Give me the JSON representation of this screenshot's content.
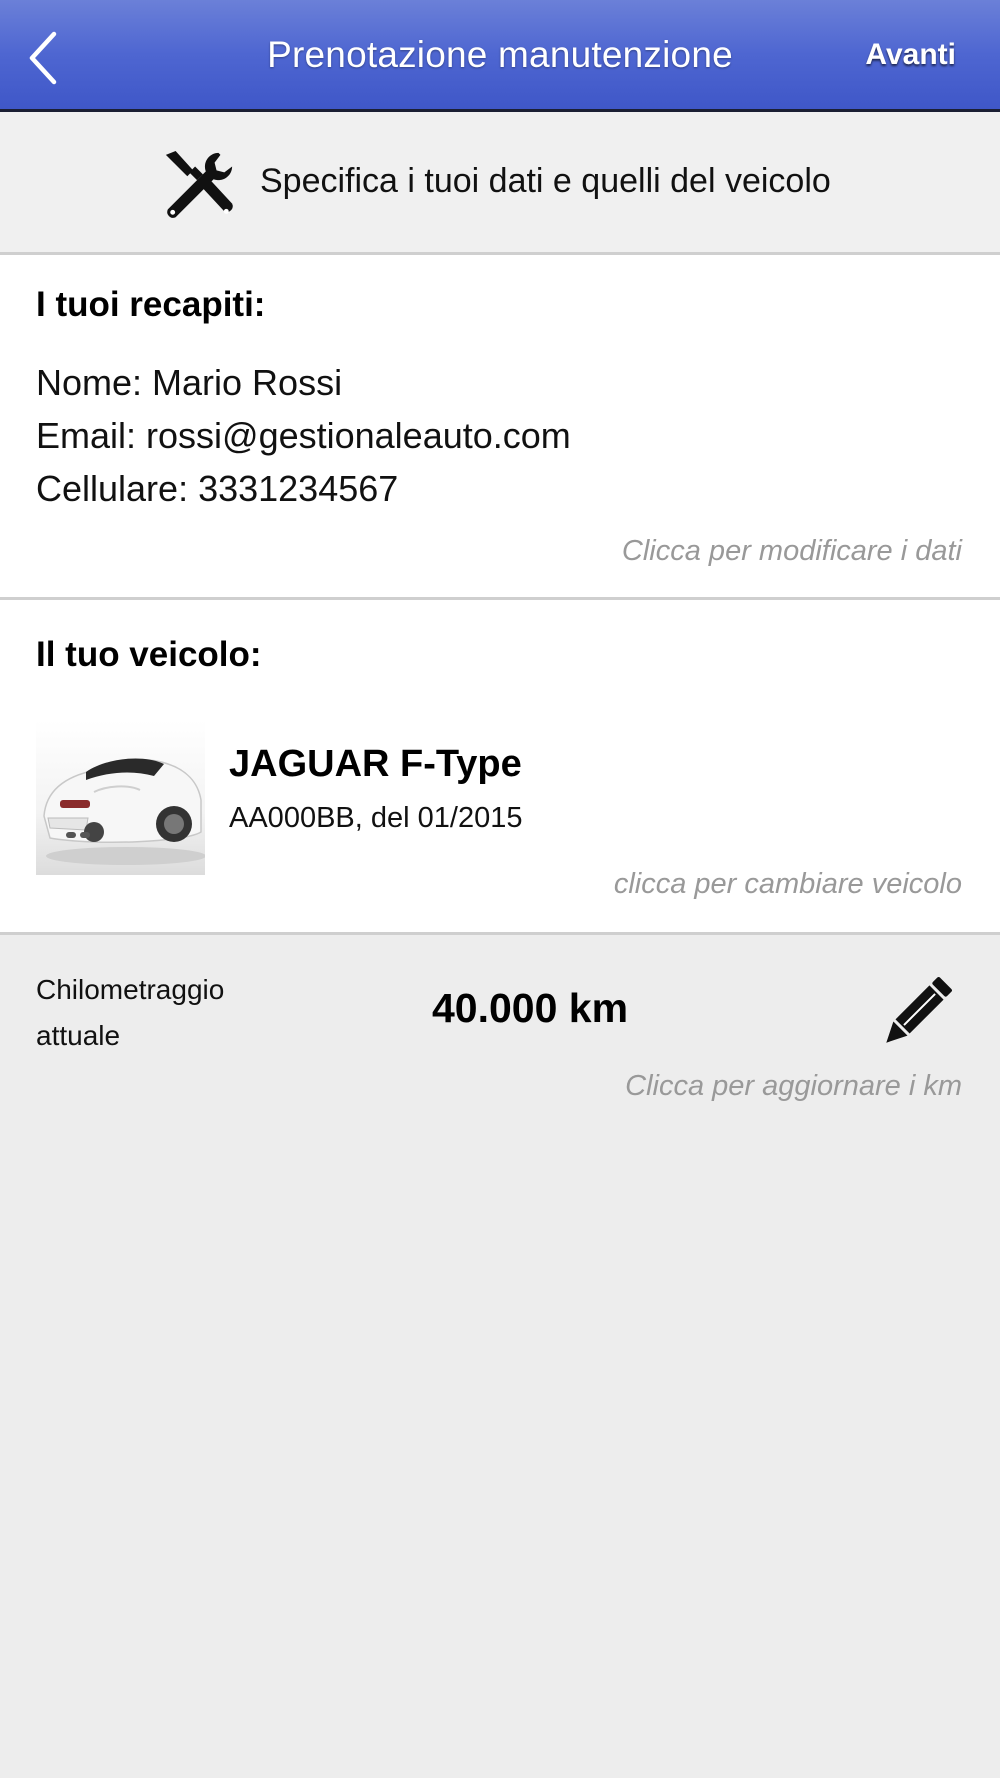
{
  "navbar": {
    "title": "Prenotazione manutenzione",
    "next_label": "Avanti",
    "accent_color": "#4e66d1"
  },
  "banner": {
    "icon": "tools-icon",
    "text": "Specifica i tuoi dati e quelli del veicolo"
  },
  "contacts": {
    "title": "I tuoi recapiti:",
    "name_line": "Nome: Mario Rossi",
    "email_line": "Email: rossi@gestionaleauto.com",
    "phone_line": "Cellulare: 3331234567",
    "hint": "Clicca per modificare i dati"
  },
  "vehicle": {
    "title": "Il tuo veicolo:",
    "name": "JAGUAR F-Type",
    "details": "AA000BB, del 01/2015",
    "hint": "clicca per cambiare veicolo"
  },
  "mileage": {
    "label_line1": "Chilometraggio",
    "label_line2": "attuale",
    "value": "40.000 km",
    "hint": "Clicca per aggiornare i km",
    "icon": "pencil-icon"
  }
}
